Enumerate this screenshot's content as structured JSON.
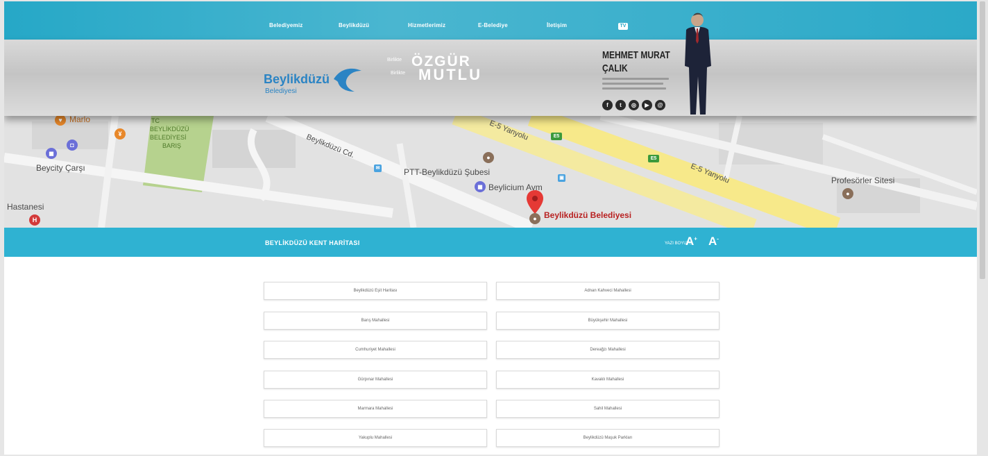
{
  "nav": {
    "items": [
      "Belediyemiz",
      "Beylikdüzü",
      "Hizmetlerimiz",
      "E-Belediye",
      "İletişim"
    ],
    "tv_label": "TV"
  },
  "header": {
    "logo_title": "Beylikdüzü",
    "logo_subtitle": "Belediyesi",
    "slogan_small_1": "Birlikte",
    "slogan_word_1": "ÖZGÜR",
    "slogan_small_2": "Birlikte",
    "slogan_word_2": "MUTLU",
    "mayor_first": "MEHMET MURAT",
    "mayor_last": "ÇALIK",
    "social_icons": [
      "facebook-icon",
      "twitter-icon",
      "instagram-icon",
      "youtube-icon",
      "web-icon"
    ]
  },
  "map": {
    "labels": {
      "market": "Marlo",
      "park1": "TC",
      "park2": "BEYLİKDÜZÜ",
      "park3": "BELEDİYESİ",
      "park4": "BARIŞ",
      "beycity": "Beycity Çarşı",
      "hastanesi": "Hastanesi",
      "ptt": "PTT-Beylikdüzü Şubesi",
      "beylicium": "Beylicium Avm",
      "belediye": "Beylikdüzü Belediyesi",
      "road_beylikduzu": "Beylikdüzü Cd.",
      "road_e5": "E-5 Yanyolu",
      "road_e5_2": "E-5 Yanyolu",
      "profesorler": "Profesörler Sitesi",
      "badge": "E5"
    }
  },
  "titlebar": {
    "title": "BEYLİKDÜZÜ KENT HARİTASI",
    "font_label": "YAZI BOYUTU",
    "font_up": "A",
    "font_down": "A"
  },
  "neighborhoods": [
    [
      "Beylikdüzü Eşit Haritası",
      "Adnan Kahveci Mahallesi"
    ],
    [
      "Barış Mahallesi",
      "Büyükşehir Mahallesi"
    ],
    [
      "Cumhuriyet Mahallesi",
      "Dereağzı Mahallesi"
    ],
    [
      "Gürpınar Mahallesi",
      "Kavaklı Mahallesi"
    ],
    [
      "Marmara Mahallesi",
      "Sahil Mahallesi"
    ],
    [
      "Yakuplu Mahallesi",
      "Beylikdüzü Maşuk Parkları"
    ]
  ],
  "colors": {
    "nav_bg": "#26a8c7",
    "titlebar_bg": "#2fb2d2",
    "brand_blue": "#2b84c4",
    "map_pin": "#e53935"
  }
}
